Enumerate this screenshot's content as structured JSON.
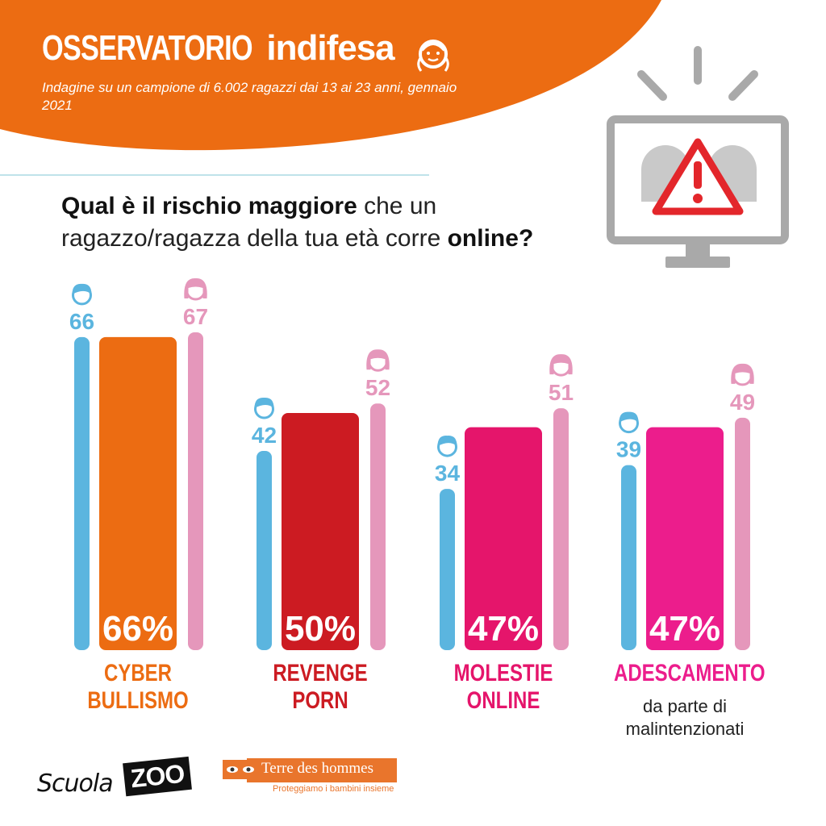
{
  "header": {
    "brand_part1": "OSSERVATORIO",
    "brand_part2": "indifesa",
    "subtitle": "Indagine su un campione di 6.002 ragazzi dai 13 ai 23 anni, gennaio 2021"
  },
  "question": {
    "bold1": "Qual è il rischio maggiore",
    "text1": " che un ragazzo/ragazza della tua età corre ",
    "bold2": "online?"
  },
  "colors": {
    "header_orange": "#ec6c12",
    "boys_blue": "#5bb5df",
    "girls_pink": "#e597bb",
    "cyber": "#ec6c12",
    "revenge": "#cc1b22",
    "molestie": "#e5156b",
    "adescamento": "#ec1d8c",
    "monitor_gray": "#a9a9a9",
    "warning_red": "#e3262b"
  },
  "icons": {
    "monitor": "monitor-warning-icon",
    "boy": "boy-icon",
    "girl": "girl-icon"
  },
  "chart_data": {
    "type": "bar",
    "unit": "%",
    "categories": [
      "CYBER BULLISMO",
      "REVENGE PORN",
      "MOLESTIE ONLINE",
      "ADESCAMENTO"
    ],
    "category_lines": [
      [
        "CYBER",
        "BULLISMO"
      ],
      [
        "REVENGE",
        "PORN"
      ],
      [
        "MOLESTIE",
        "ONLINE"
      ],
      [
        "ADESCAMENTO"
      ]
    ],
    "category_sub": [
      "",
      "",
      "",
      "da parte di malintenzionati"
    ],
    "category_colors": [
      "#ec6c12",
      "#cc1b22",
      "#e5156b",
      "#ec1d8c"
    ],
    "series": [
      {
        "values": [
          66,
          50,
          47,
          47
        ],
        "value_labels": [
          "66%",
          "50%",
          "47%",
          "47%"
        ]
      },
      {
        "values": [
          66,
          42,
          34,
          39
        ]
      },
      {
        "values": [
          67,
          52,
          51,
          49
        ]
      }
    ],
    "ylim": [
      0,
      70
    ]
  },
  "footer": {
    "scuola_part1": "Scuola",
    "scuola_part2": "ZOO",
    "tdh_name": "Terre des hommes",
    "tdh_tagline": "Proteggiamo i bambini insieme"
  }
}
